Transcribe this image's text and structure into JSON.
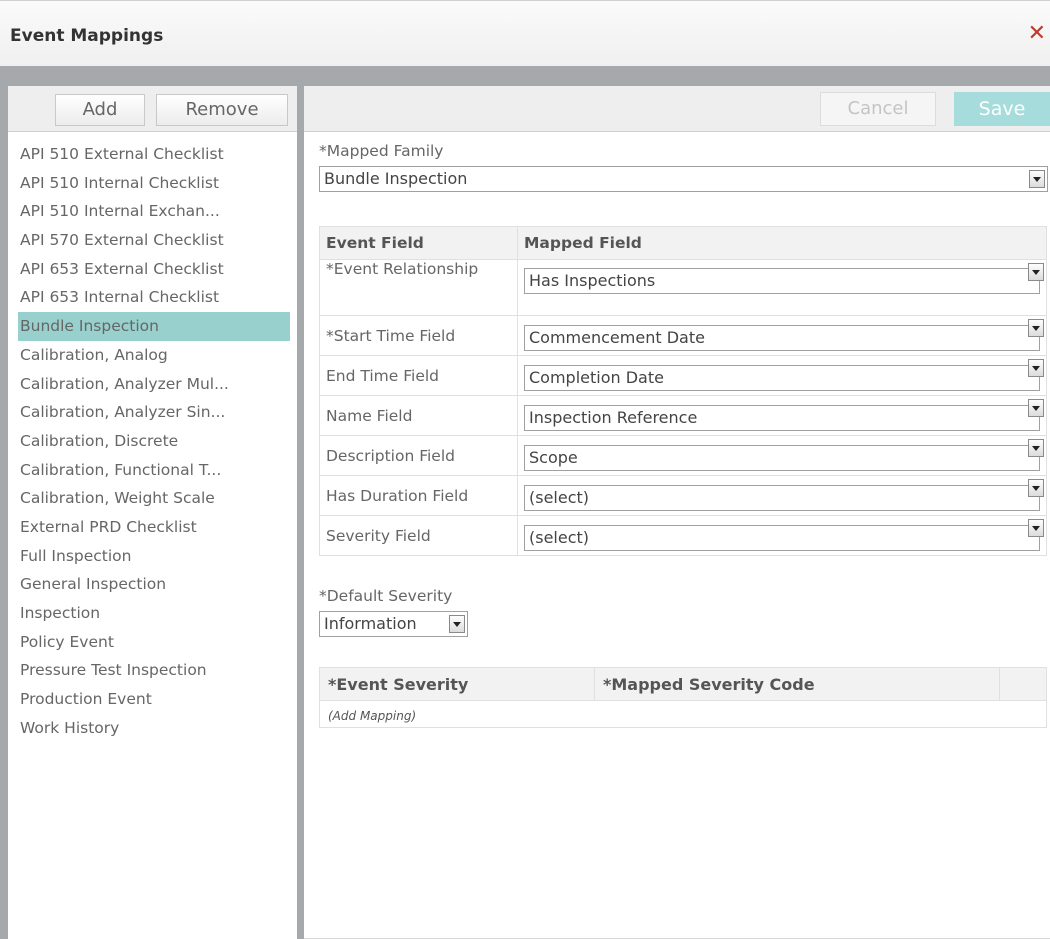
{
  "dialog": {
    "title": "Event Mappings",
    "close_glyph": "✕"
  },
  "left": {
    "add_label": "Add",
    "remove_label": "Remove",
    "items": [
      "API 510 External Checklist",
      "API 510 Internal Checklist",
      "API 510 Internal Exchan...",
      "API 570 External Checklist",
      "API 653 External Checklist",
      "API 653 Internal Checklist",
      "Bundle Inspection",
      "Calibration, Analog",
      "Calibration, Analyzer Mul...",
      "Calibration, Analyzer Sin...",
      "Calibration, Discrete",
      "Calibration, Functional T...",
      "Calibration, Weight Scale",
      "External PRD Checklist",
      "Full Inspection",
      "General Inspection",
      "Inspection",
      "Policy Event",
      "Pressure Test Inspection",
      "Production Event",
      "Work History"
    ],
    "selected_index": 6
  },
  "right": {
    "cancel_label": "Cancel",
    "save_label": "Save",
    "mapped_family_label": "*Mapped Family",
    "mapped_family_value": "Bundle Inspection",
    "fields_table": {
      "headers": [
        "Event Field",
        "Mapped Field"
      ],
      "rows": [
        {
          "field": "*Event Relationship",
          "value": "Has Inspections"
        },
        {
          "field": "*Start Time Field",
          "value": "Commencement Date"
        },
        {
          "field": "End Time Field",
          "value": "Completion Date"
        },
        {
          "field": "Name Field",
          "value": "Inspection Reference"
        },
        {
          "field": "Description Field",
          "value": "Scope"
        },
        {
          "field": "Has Duration Field",
          "value": "(select)"
        },
        {
          "field": "Severity Field",
          "value": "(select)"
        }
      ]
    },
    "default_severity_label": "*Default Severity",
    "default_severity_value": "Information",
    "severity_table": {
      "headers": [
        "*Event Severity",
        "*Mapped Severity Code",
        ""
      ],
      "add_mapping_label": "(Add Mapping)"
    }
  },
  "colors": {
    "selected_item": "#97d0cc",
    "save_button": "#a6dcdc",
    "close": "#c0392b",
    "frame": "#a5a9ab"
  }
}
